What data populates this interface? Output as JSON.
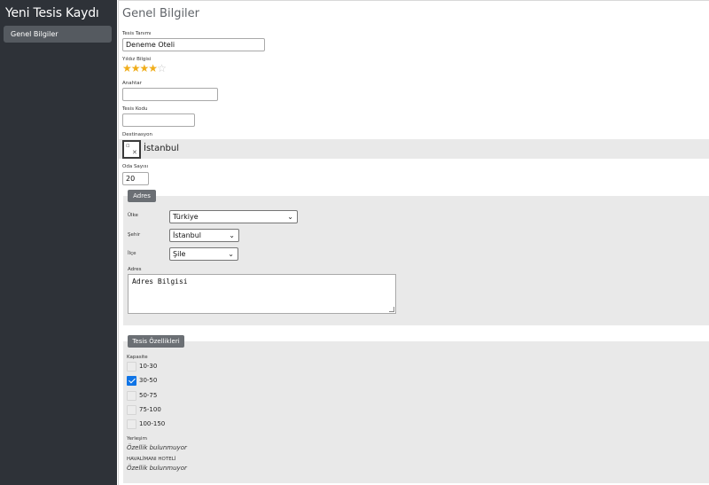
{
  "sidebar": {
    "title": "Yeni Tesis Kaydı",
    "items": [
      {
        "label": "Genel Bilgiler",
        "active": true
      }
    ]
  },
  "main": {
    "title": "Genel Bilgiler",
    "tesis_tanimi": {
      "label": "Tesis Tanımı",
      "value": "Deneme Oteli"
    },
    "yildiz": {
      "label": "Yıldız Bilgisi",
      "rating": 4,
      "max": 5
    },
    "anahtar": {
      "label": "Anahtar",
      "value": ""
    },
    "tesis_kodu": {
      "label": "Tesis Kodu",
      "value": ""
    },
    "destinasyon": {
      "label": "Destinasyon",
      "value": "İstanbul",
      "icon": "broken-image-icon"
    },
    "oda_sayisi": {
      "label": "Oda Sayısı",
      "value": "20"
    },
    "adres": {
      "legend": "Adres",
      "ulke": {
        "label": "Ülke",
        "value": "Türkiye"
      },
      "sehir": {
        "label": "Şehir",
        "value": "İstanbul"
      },
      "ilce": {
        "label": "İlçe",
        "value": "Şile"
      },
      "adres": {
        "label": "Adres",
        "value": "Adres Bilgisi"
      }
    },
    "ozellikler": {
      "legend": "Tesis Özellikleri",
      "kapasite": {
        "label": "Kapasite",
        "options": [
          {
            "label": "10-30",
            "checked": false
          },
          {
            "label": "30-50",
            "checked": true
          },
          {
            "label": "50-75",
            "checked": false
          },
          {
            "label": "75-100",
            "checked": false
          },
          {
            "label": "100-150",
            "checked": false
          }
        ]
      },
      "yerlesim": {
        "label": "Yerleşim",
        "value": "Özellik bulunmuyor"
      },
      "havalimani": {
        "label": "HAVALİMANI HOTELİ",
        "value": "Özellik bulunmuyor"
      }
    }
  },
  "colors": {
    "sidebar_bg": "#2e3238",
    "accent": "#0f74e6",
    "star": "#f0ad1a",
    "section_bg": "#e9e9e9"
  }
}
